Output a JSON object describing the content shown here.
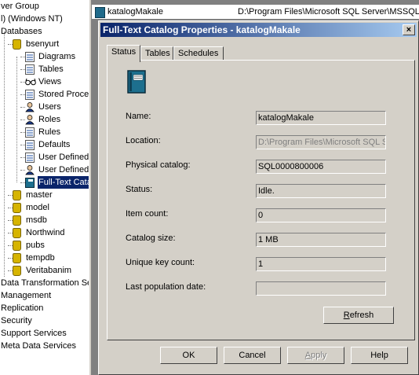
{
  "tree": {
    "items": [
      {
        "label": "ver Group",
        "indent": 0,
        "icon": ""
      },
      {
        "label": "l) (Windows NT)",
        "indent": 0,
        "icon": ""
      },
      {
        "label": "Databases",
        "indent": 0,
        "icon": ""
      },
      {
        "label": "bsenyurt",
        "indent": 1,
        "icon": "database-icon"
      },
      {
        "label": "Diagrams",
        "indent": 2,
        "icon": "diagram-icon"
      },
      {
        "label": "Tables",
        "indent": 2,
        "icon": "table-icon"
      },
      {
        "label": "Views",
        "indent": 2,
        "icon": "glasses-icon"
      },
      {
        "label": "Stored Procedur",
        "indent": 2,
        "icon": "scroll-icon"
      },
      {
        "label": "Users",
        "indent": 2,
        "icon": "user-icon"
      },
      {
        "label": "Roles",
        "indent": 2,
        "icon": "roles-icon"
      },
      {
        "label": "Rules",
        "indent": 2,
        "icon": "rule-icon"
      },
      {
        "label": "Defaults",
        "indent": 2,
        "icon": "defaults-icon"
      },
      {
        "label": "User Defined Da",
        "indent": 2,
        "icon": "udt-icon"
      },
      {
        "label": "User Defined Fu",
        "indent": 2,
        "icon": "udf-icon"
      },
      {
        "label": "Full-Text Catalog",
        "indent": 2,
        "icon": "catalog-icon",
        "selected": true
      },
      {
        "label": "master",
        "indent": 1,
        "icon": "database-icon"
      },
      {
        "label": "model",
        "indent": 1,
        "icon": "database-icon"
      },
      {
        "label": "msdb",
        "indent": 1,
        "icon": "database-icon"
      },
      {
        "label": "Northwind",
        "indent": 1,
        "icon": "database-icon"
      },
      {
        "label": "pubs",
        "indent": 1,
        "icon": "database-icon"
      },
      {
        "label": "tempdb",
        "indent": 1,
        "icon": "database-icon"
      },
      {
        "label": "Veritabanim",
        "indent": 1,
        "icon": "database-icon"
      },
      {
        "label": "Data Transformation Ser",
        "indent": 0,
        "icon": ""
      },
      {
        "label": "Management",
        "indent": 0,
        "icon": ""
      },
      {
        "label": "Replication",
        "indent": 0,
        "icon": ""
      },
      {
        "label": "Security",
        "indent": 0,
        "icon": ""
      },
      {
        "label": "Support Services",
        "indent": 0,
        "icon": ""
      },
      {
        "label": "Meta Data Services",
        "indent": 0,
        "icon": ""
      }
    ]
  },
  "list": {
    "name": "katalogMakale",
    "path": "D:\\Program Files\\Microsoft SQL Server\\MSSQL\\"
  },
  "dialog": {
    "title": "Full-Text Catalog Properties - katalogMakale",
    "close_label": "×",
    "tabs": [
      "Status",
      "Tables",
      "Schedules"
    ],
    "active_tab": "Status",
    "fields": [
      {
        "label": "Name:",
        "value": "katalogMakale",
        "dim": false
      },
      {
        "label": "Location:",
        "value": "D:\\Program Files\\Microsoft SQL S",
        "dim": true
      },
      {
        "label": "Physical catalog:",
        "value": "SQL0000800006",
        "dim": false
      },
      {
        "label": "Status:",
        "value": "Idle.",
        "dim": false
      },
      {
        "label": "Item count:",
        "value": "0",
        "dim": false
      },
      {
        "label": "Catalog size:",
        "value": "1 MB",
        "dim": false
      },
      {
        "label": "Unique key count:",
        "value": "1",
        "dim": false
      },
      {
        "label": "Last population date:",
        "value": "",
        "dim": false
      }
    ],
    "refresh_label": "Refresh",
    "buttons": {
      "ok": "OK",
      "cancel": "Cancel",
      "apply": "Apply",
      "help": "Help"
    }
  },
  "colors": {
    "title_start": "#0a246a",
    "title_end": "#a6caf0",
    "face": "#d4d0c8",
    "selection": "#0a246a"
  }
}
